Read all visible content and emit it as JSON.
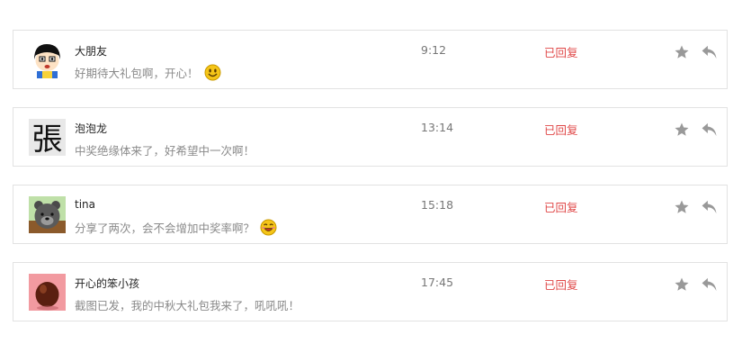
{
  "messages": [
    {
      "name": "大朋友",
      "text": "好期待大礼包啊，开心！",
      "time": "9:12",
      "status": "已回复",
      "avatar": "cartoon-boy-avatar",
      "emoji": "smile-emoji"
    },
    {
      "name": "泡泡龙",
      "text": "中奖绝缘体来了，好希望中一次啊！",
      "time": "13:14",
      "status": "已回复",
      "avatar": "calligraphy-zhang-avatar",
      "emoji": ""
    },
    {
      "name": "tina",
      "text": "分享了两次，会不会增加中奖率啊？",
      "time": "15:18",
      "status": "已回复",
      "avatar": "bear-avatar",
      "emoji": "grin-emoji"
    },
    {
      "name": "开心的笨小孩",
      "text": "截图已发，我的中秋大礼包我来了，吼吼吼！",
      "time": "17:45",
      "status": "已回复",
      "avatar": "red-ball-avatar",
      "emoji": ""
    }
  ],
  "avatar_glyph": "張",
  "colors": {
    "status": "#e04848",
    "icon": "#999999",
    "border": "#e2e2e2"
  }
}
